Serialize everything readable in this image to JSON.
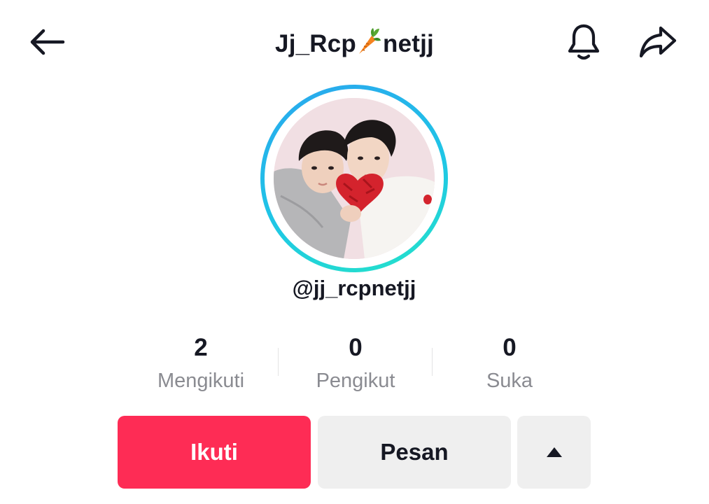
{
  "header": {
    "title_part1": "Jj_Rcp",
    "title_emoji": "carrot",
    "title_part2": "netjj",
    "back_icon": "arrow-left-icon",
    "bell_icon": "bell-icon",
    "share_icon": "share-arrow-icon"
  },
  "profile": {
    "handle": "@jj_rcpnetjj",
    "ring_colors": [
      "#2aa6ee",
      "#25e3c8"
    ]
  },
  "stats": {
    "following": {
      "value": "2",
      "label": "Mengikuti"
    },
    "followers": {
      "value": "0",
      "label": "Pengikut"
    },
    "likes": {
      "value": "0",
      "label": "Suka"
    }
  },
  "actions": {
    "follow_label": "Ikuti",
    "message_label": "Pesan",
    "more_icon": "triangle-up-icon"
  },
  "colors": {
    "primary": "#fe2c55",
    "secondary_button": "#efefef",
    "text": "#161823",
    "muted_text": "#8a8b91"
  }
}
